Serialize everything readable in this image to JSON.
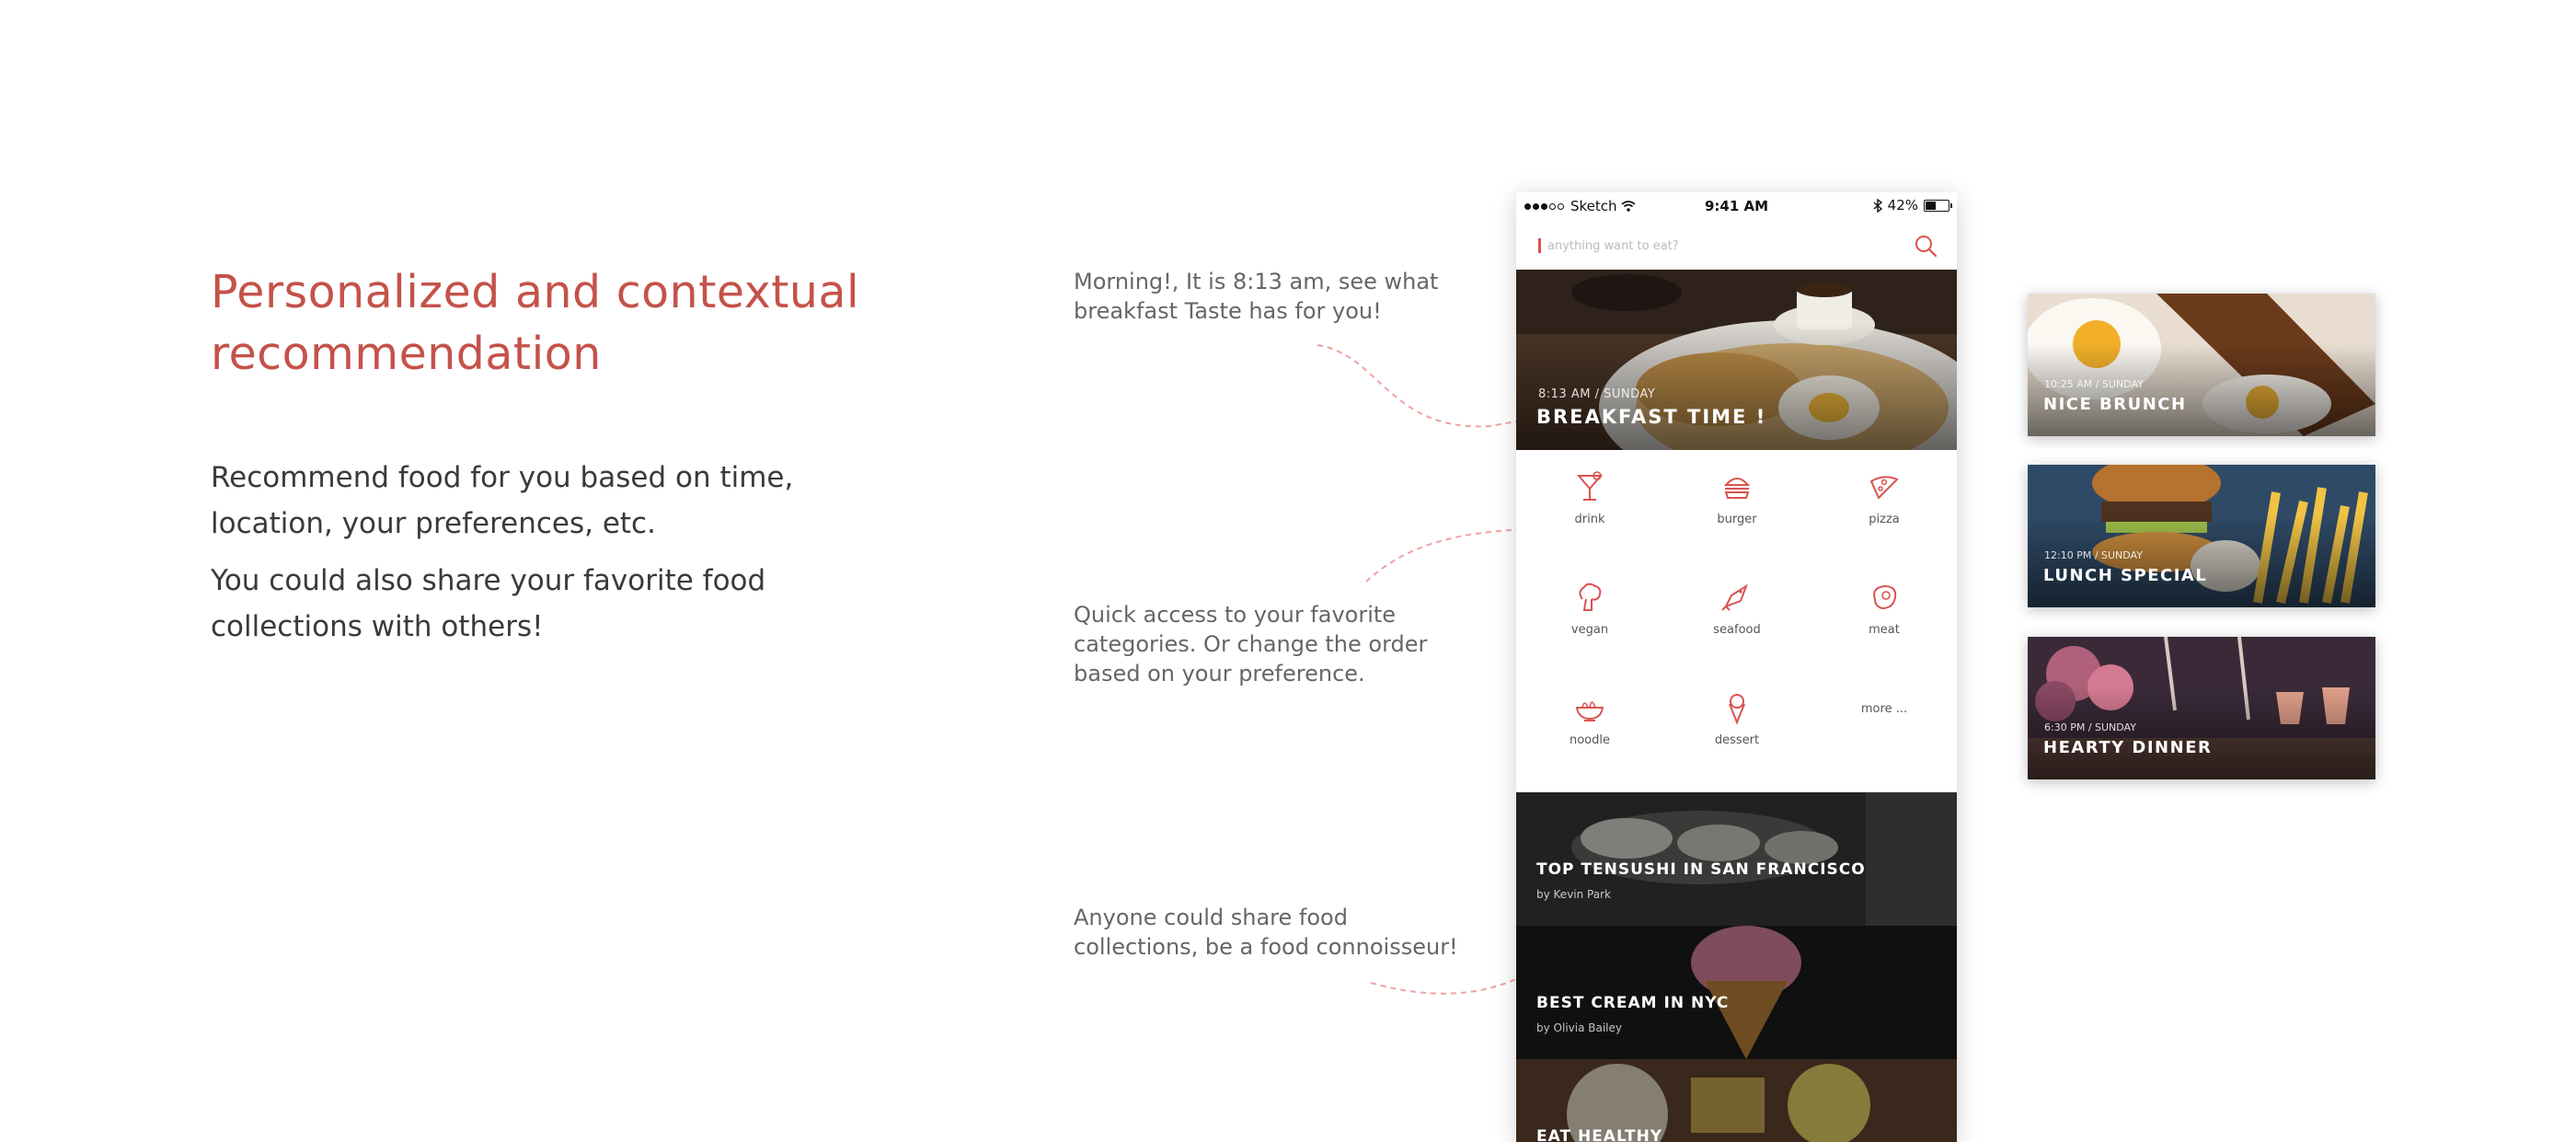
{
  "left_panel": {
    "headline": "Personalized and contextual recommendation",
    "paragraph_1": "Recommend food for you based on time, location, your preferences, etc.",
    "paragraph_2": "You could also share your favorite food collections with others!"
  },
  "annotations": {
    "breakfast": "Morning!, It is 8:13 am, see what breakfast Taste has for you!",
    "categories": "Quick access to your favorite categories. Or change the order based on your preference.",
    "collections": "Anyone could share food collections, be a food connoisseur!"
  },
  "colors": {
    "accent": "#c4524a",
    "icon_red": "#d9534f",
    "connector": "#f2a0a0"
  },
  "phone": {
    "statusbar": {
      "carrier": "Sketch",
      "time": "9:41 AM",
      "battery": "42%",
      "battery_level": 0.42,
      "signal_icon": "signal-dots-icon",
      "wifi_icon": "wifi-icon",
      "bluetooth_icon": "bluetooth-icon"
    },
    "search": {
      "placeholder": "anything want to eat?",
      "icon": "search-icon"
    },
    "hero": {
      "subtitle": "8:13 AM / SUNDAY",
      "title": "BREAKFAST TIME !"
    },
    "categories": [
      {
        "label": "drink",
        "icon": "cocktail-icon"
      },
      {
        "label": "burger",
        "icon": "burger-icon"
      },
      {
        "label": "pizza",
        "icon": "pizza-icon"
      },
      {
        "label": "vegan",
        "icon": "broccoli-icon"
      },
      {
        "label": "seafood",
        "icon": "fish-icon"
      },
      {
        "label": "meat",
        "icon": "steak-icon"
      },
      {
        "label": "noodle",
        "icon": "noodle-bowl-icon"
      },
      {
        "label": "dessert",
        "icon": "ice-cream-icon"
      }
    ],
    "more_label": "more ...",
    "collections": [
      {
        "title": "TOP TENSUSHI IN SAN FRANCISCO",
        "author": "by Kevin Park"
      },
      {
        "title": "BEST CREAM IN NYC",
        "author": "by Olivia Bailey"
      },
      {
        "title": "EAT HEALTHY",
        "author": ""
      }
    ]
  },
  "side_cards": [
    {
      "subtitle": "10:25 AM / SUNDAY",
      "title": "NICE BRUNCH"
    },
    {
      "subtitle": "12:10 PM / SUNDAY",
      "title": "LUNCH SPECIAL"
    },
    {
      "subtitle": "6:30 PM / SUNDAY",
      "title": "HEARTY DINNER"
    }
  ]
}
